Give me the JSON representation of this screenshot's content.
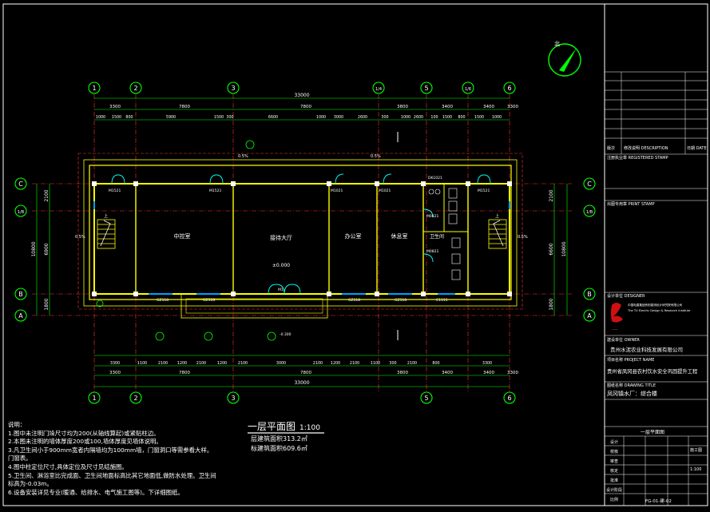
{
  "plan": {
    "title": "一层平面图",
    "scale": "1:100",
    "area_floor": "层建筑面积313.2㎡",
    "area_total": "标建筑面积609.6㎡",
    "north": "北"
  },
  "grids": {
    "top": [
      "1",
      "2",
      "3",
      "1/4",
      "5",
      "1/6",
      "6"
    ],
    "bottom": [
      "1",
      "2",
      "3",
      "5",
      "6"
    ],
    "left": [
      "C",
      "1/B",
      "B",
      "A"
    ],
    "right": [
      "C",
      "1/B",
      "B",
      "A"
    ]
  },
  "dims": {
    "top_total": "33000",
    "top_bays": [
      "3300",
      "7800",
      "7800",
      "3800",
      "3400",
      "3400",
      "3300"
    ],
    "top_detail": [
      "1000",
      "1500",
      "800",
      "5900",
      "1500",
      "300",
      "6600",
      "1000",
      "3000",
      "2600",
      "300",
      "1000",
      "2600",
      "100",
      "1500",
      "800",
      "1500",
      "1000"
    ],
    "bottom_detail": [
      "3300",
      "1100",
      "2100",
      "1200",
      "2100",
      "1200",
      "2100",
      "3000",
      "2100",
      "1200",
      "2100",
      "1100",
      "300",
      "2100",
      "800",
      "3300"
    ],
    "bottom_bays": [
      "3300",
      "7800",
      "7800",
      "3800",
      "3400",
      "3400",
      "3300"
    ],
    "bottom_total": "33000",
    "left_total": "10800",
    "left_parts": [
      "2100",
      "6900",
      "1800"
    ],
    "right_total": "10800",
    "right_parts": [
      "2100",
      "6600",
      "1800"
    ]
  },
  "rooms": {
    "r1": "中控室",
    "r2": "接待大厅",
    "r3": "办公室",
    "r4": "休息室",
    "r5": "卫生间",
    "stair_up": "上",
    "elev": "±0.000",
    "slope": "0.5%"
  },
  "tags": {
    "door1": "M1521",
    "door2": "M1521",
    "door3": "M1021",
    "door4": "M1021",
    "door5": "M1521",
    "door6": "M0821",
    "door7": "M0821",
    "door8": "DK1021",
    "main_door": "M1",
    "w1": "GZ118",
    "w2": "GZ118",
    "w3": "GZ118",
    "w4": "GZ118",
    "w5": "C1515",
    "elev2": "-0.300"
  },
  "notes": [
    "说明：",
    "1.图中未注明门垛尺寸均为200(从轴线算起)或紧贴柱边。",
    "2.本图未注明的墙体厚度200或100,墙体厚度见墙体说明。",
    "3.凡卫生间小于900mm宽者内隔墙均为100mm墙，门窗洞口等需参看大样。",
    "  门窗表。",
    "4.图中柱定位尺寸,具体定位及尺寸见结施图。",
    "5.卫生间、淋浴室比完成面、卫生间地面标高比其它地面低,做防水处理。卫生间",
    "  标高为-0.03m。",
    "6.设备安装详见专业(暖通、给排水、电气施工图等)。下详细图纸。"
  ],
  "titleblock": {
    "stamp_label": "注册执业章 REGISTERED STAMP",
    "seal_label": "出图专用章 PRINT STAMP",
    "rev_col1": "版次",
    "rev_col2": "修改说明 DESCRIPTION",
    "rev_col3": "日期 DATE",
    "designer_label": "设计单位 DESIGNER",
    "designer_name": "中国电建集团贵阳勘测设计研究院有限公司",
    "designer_en": "The TU Electric Design & Research Institute",
    "owner_label": "建设单位 OWNER",
    "owner_name": "贵州水泥农业科技发展有限公司",
    "project_label": "项目名称 PROJECT NAME",
    "project_name": "贵州省凤冈县农村饮水安全巩固提升工程",
    "drawing_label": "图纸名称 DRAWING TITLE",
    "drawing_name": "凤冈镇水厂：综合楼",
    "sheet_title": "一层平面图",
    "rows": [
      "设计",
      "校核",
      "审查",
      "核定",
      "批准",
      "设计阶段",
      "比例"
    ],
    "stage": "施工图",
    "scale": "1:100",
    "sheet_no": "FG-01-建-02"
  },
  "colors": {
    "frame": "#ffffff",
    "wall": "#ffff00",
    "dim": "#00ff00",
    "axis": "#ff3333",
    "door": "#00ffff",
    "glass": "#00a0ff"
  }
}
